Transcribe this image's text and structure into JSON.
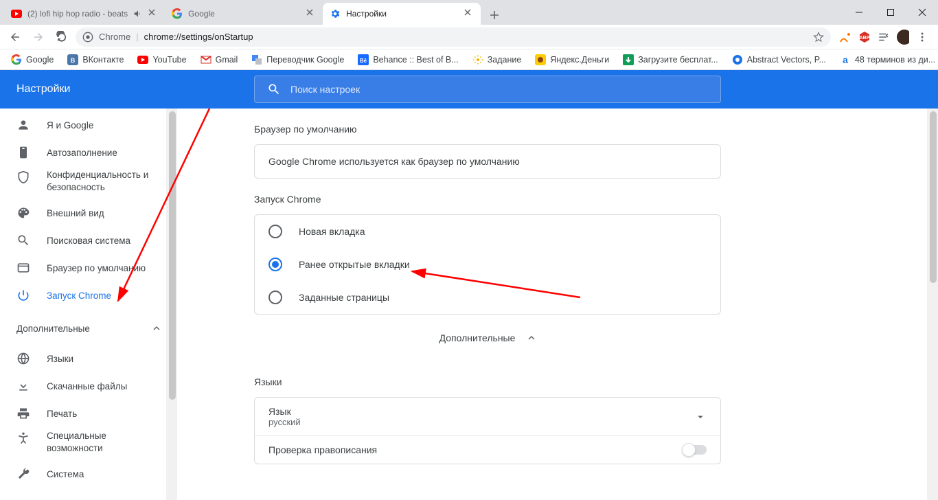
{
  "tabs": [
    {
      "title": "(2) lofi hip hop radio - beats",
      "favicon": "youtube",
      "audio": true
    },
    {
      "title": "Google",
      "favicon": "google"
    },
    {
      "title": "Настройки",
      "favicon": "gear",
      "active": true
    }
  ],
  "omnibox": {
    "prefix": "Chrome",
    "url": "chrome://settings/onStartup"
  },
  "bookmarks": [
    {
      "label": "Google",
      "icon": "google"
    },
    {
      "label": "ВКонтакте",
      "icon": "vk"
    },
    {
      "label": "YouTube",
      "icon": "youtube"
    },
    {
      "label": "Gmail",
      "icon": "gmail"
    },
    {
      "label": "Переводчик Google",
      "icon": "translate"
    },
    {
      "label": "Behance :: Best of B...",
      "icon": "behance"
    },
    {
      "label": "Задание",
      "icon": "gear2"
    },
    {
      "label": "Яндекс.Деньги",
      "icon": "yandex"
    },
    {
      "label": "Загрузите бесплат...",
      "icon": "dl"
    },
    {
      "label": "Abstract Vectors, P...",
      "icon": "abstract"
    },
    {
      "label": "48 терминов из ди...",
      "icon": "a"
    }
  ],
  "header": {
    "title": "Настройки",
    "search_placeholder": "Поиск настроек"
  },
  "sidebar": {
    "items": [
      {
        "icon": "person",
        "label": "Я и Google"
      },
      {
        "icon": "clipboard",
        "label": "Автозаполнение"
      },
      {
        "icon": "shield",
        "label": "Конфиденциальность и безопасность",
        "multiline": true
      },
      {
        "icon": "palette",
        "label": "Внешний вид"
      },
      {
        "icon": "search",
        "label": "Поисковая система"
      },
      {
        "icon": "browser",
        "label": "Браузер по умолчанию"
      },
      {
        "icon": "power",
        "label": "Запуск Chrome",
        "active": true
      }
    ],
    "advanced_label": "Дополнительные",
    "adv_items": [
      {
        "icon": "globe",
        "label": "Языки"
      },
      {
        "icon": "download",
        "label": "Скачанные файлы"
      },
      {
        "icon": "print",
        "label": "Печать"
      },
      {
        "icon": "accessibility",
        "label": "Специальные возможности",
        "multiline": true
      },
      {
        "icon": "wrench",
        "label": "Система"
      }
    ]
  },
  "sections": {
    "default_browser": {
      "title": "Браузер по умолчанию",
      "text": "Google Chrome используется как браузер по умолчанию"
    },
    "startup": {
      "title": "Запуск Chrome",
      "options": [
        {
          "label": "Новая вкладка",
          "checked": false
        },
        {
          "label": "Ранее открытые вкладки",
          "checked": true
        },
        {
          "label": "Заданные страницы",
          "checked": false
        }
      ]
    },
    "advanced_toggle": "Дополнительные",
    "languages": {
      "title": "Языки",
      "lang_label": "Язык",
      "lang_value": "русский",
      "spellcheck_label": "Проверка правописания"
    }
  }
}
